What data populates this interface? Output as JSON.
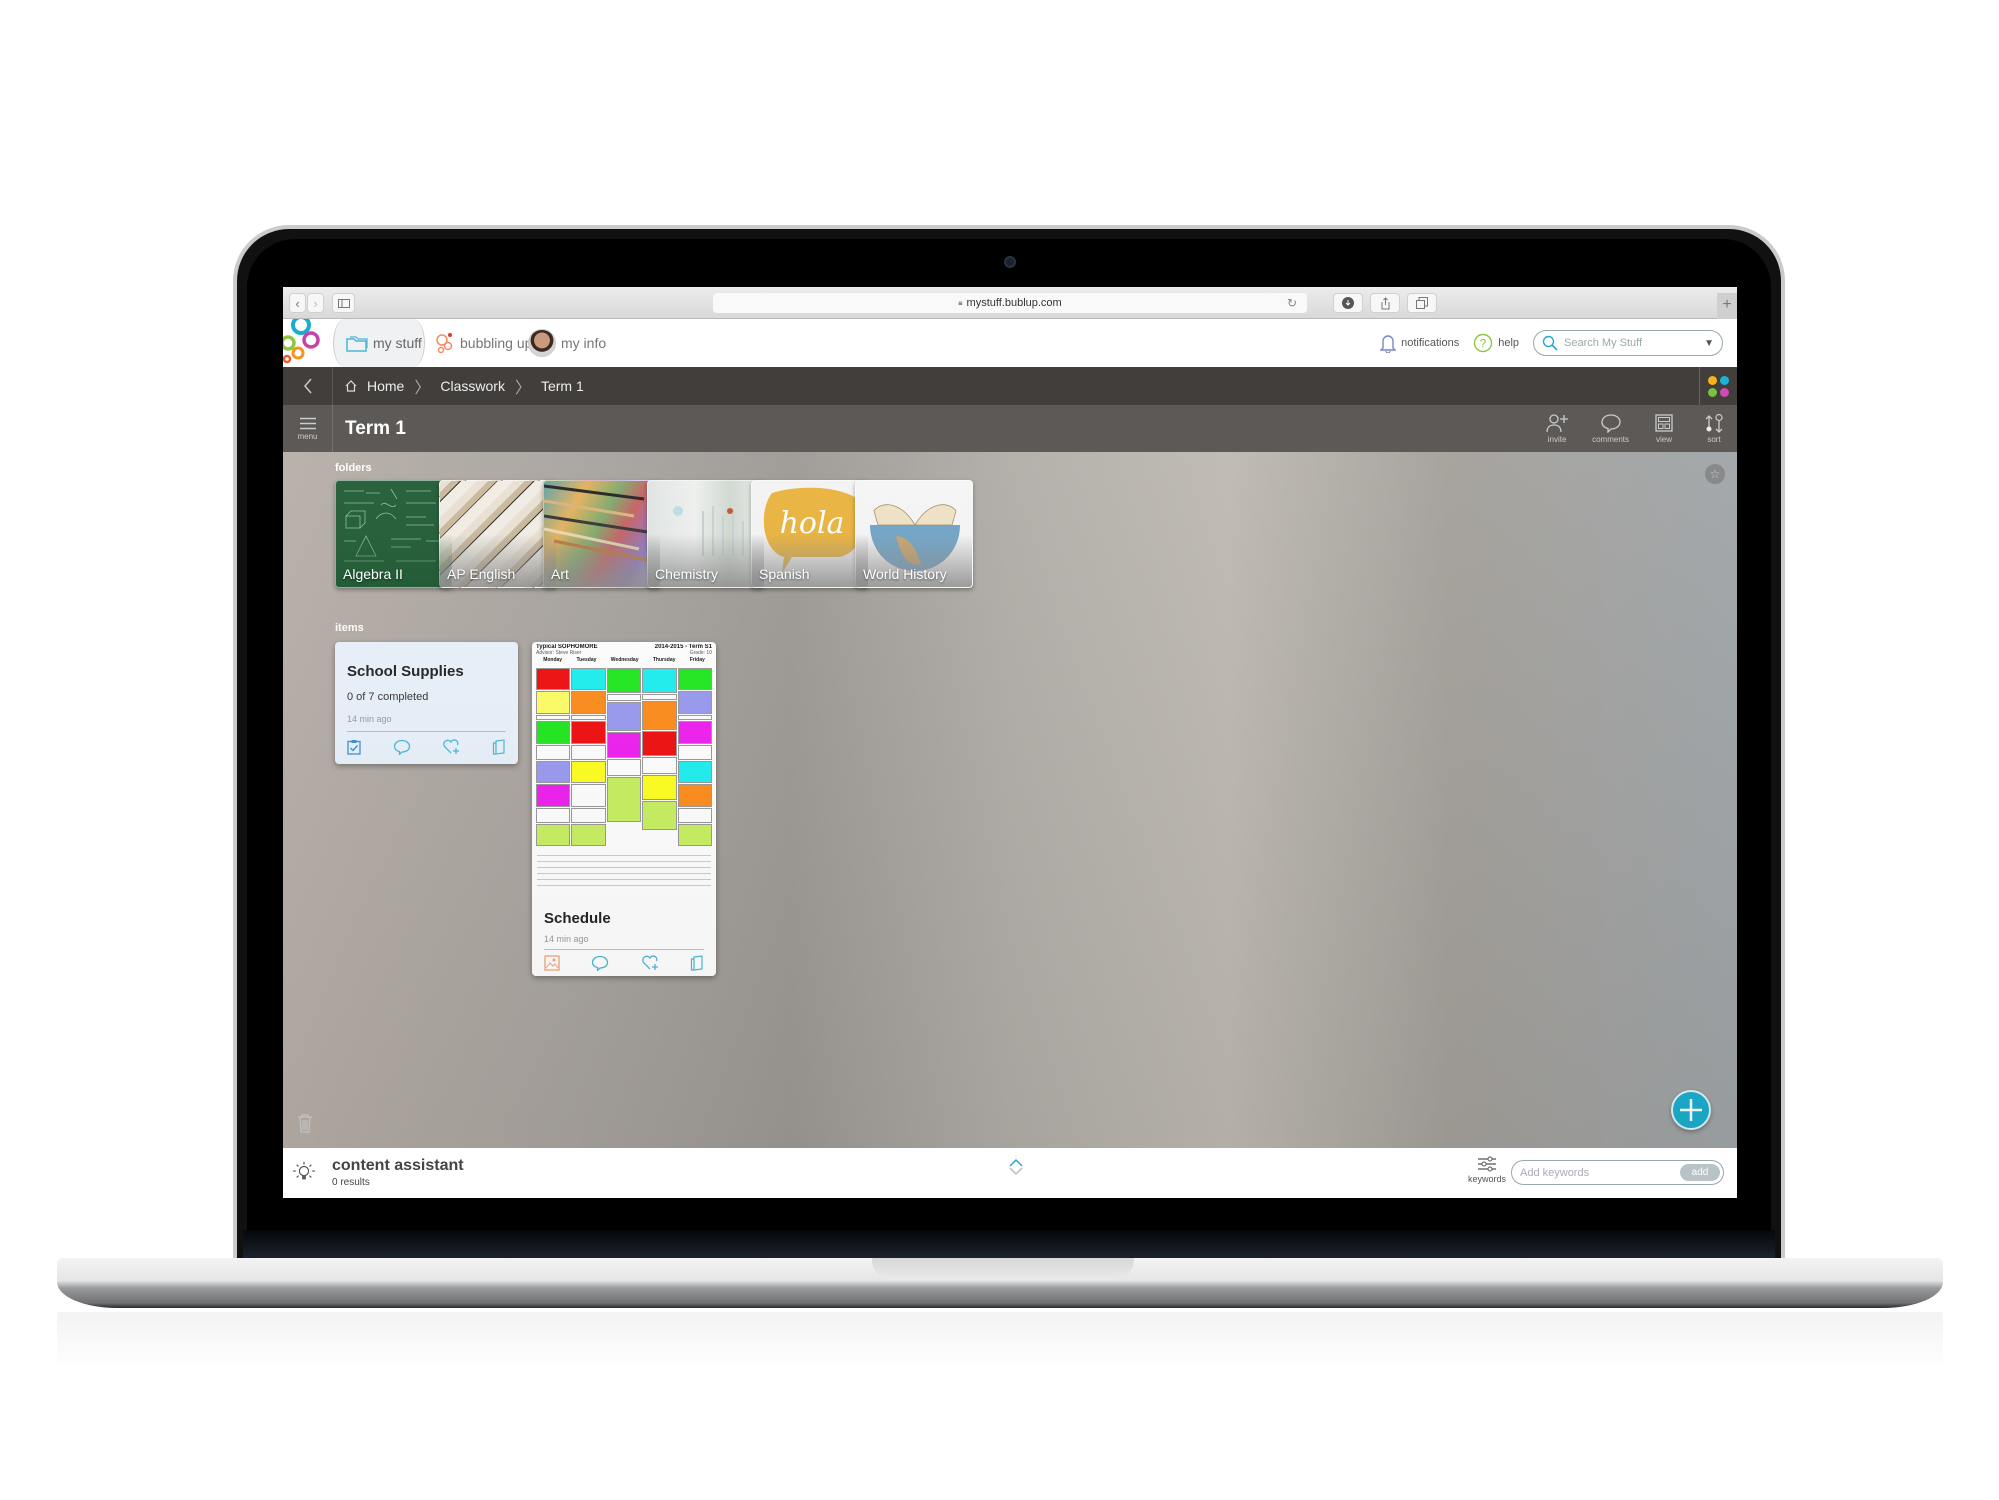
{
  "browser": {
    "url": "mystuff.bublup.com",
    "back_label": "‹",
    "forward_label": "›",
    "new_tab_label": "+"
  },
  "nav": {
    "tabs": [
      {
        "label": "my stuff",
        "icon": "folders-icon",
        "active": true
      },
      {
        "label": "bubbling up",
        "icon": "bubbles-icon",
        "badge": true
      },
      {
        "label": "my info",
        "icon": "avatar"
      }
    ],
    "notifications_label": "notifications",
    "help_label": "help",
    "search_placeholder": "Search My Stuff"
  },
  "breadcrumb": {
    "items": [
      "Home",
      "Classwork",
      "Term 1"
    ]
  },
  "title_bar": {
    "menu_label": "menu",
    "title": "Term 1",
    "tools": [
      {
        "label": "invite",
        "icon": "invite-icon"
      },
      {
        "label": "comments",
        "icon": "comments-icon"
      },
      {
        "label": "view",
        "icon": "view-icon"
      },
      {
        "label": "sort",
        "icon": "sort-icon"
      }
    ]
  },
  "content": {
    "folders_label": "folders",
    "items_label": "items",
    "folders": [
      {
        "name": "Algebra II"
      },
      {
        "name": "AP English"
      },
      {
        "name": "Art"
      },
      {
        "name": "Chemistry"
      },
      {
        "name": "Spanish",
        "image_text": "hola"
      },
      {
        "name": "World History"
      }
    ],
    "items": [
      {
        "title": "School Supplies",
        "subtitle": "0 of 7 completed",
        "time": "14 min ago",
        "progress": {
          "completed": 0,
          "total": 7
        }
      },
      {
        "title": "Schedule",
        "time": "14 min ago",
        "thumbnail": {
          "heading": "Typical SOPHOMORE",
          "term": "2014-2015 - Term S1",
          "advisor": "Advisor: Steve Riser",
          "grade": "Grade: 10",
          "days": [
            "Monday",
            "Tuesday",
            "Wednesday",
            "Thursday",
            "Friday"
          ]
        }
      }
    ]
  },
  "bottom_bar": {
    "title": "content assistant",
    "results": "0 results",
    "keywords_label": "keywords",
    "keywords_placeholder": "Add keywords",
    "add_label": "add"
  },
  "colors": {
    "accent": "#1aaecd",
    "logo": [
      "#1aaecd",
      "#8dc63f",
      "#c843a8",
      "#f7941d",
      "#f15a29"
    ],
    "apps_dots": [
      "#f6b21b",
      "#1ab5d5",
      "#7ac142",
      "#d24bb2"
    ]
  }
}
